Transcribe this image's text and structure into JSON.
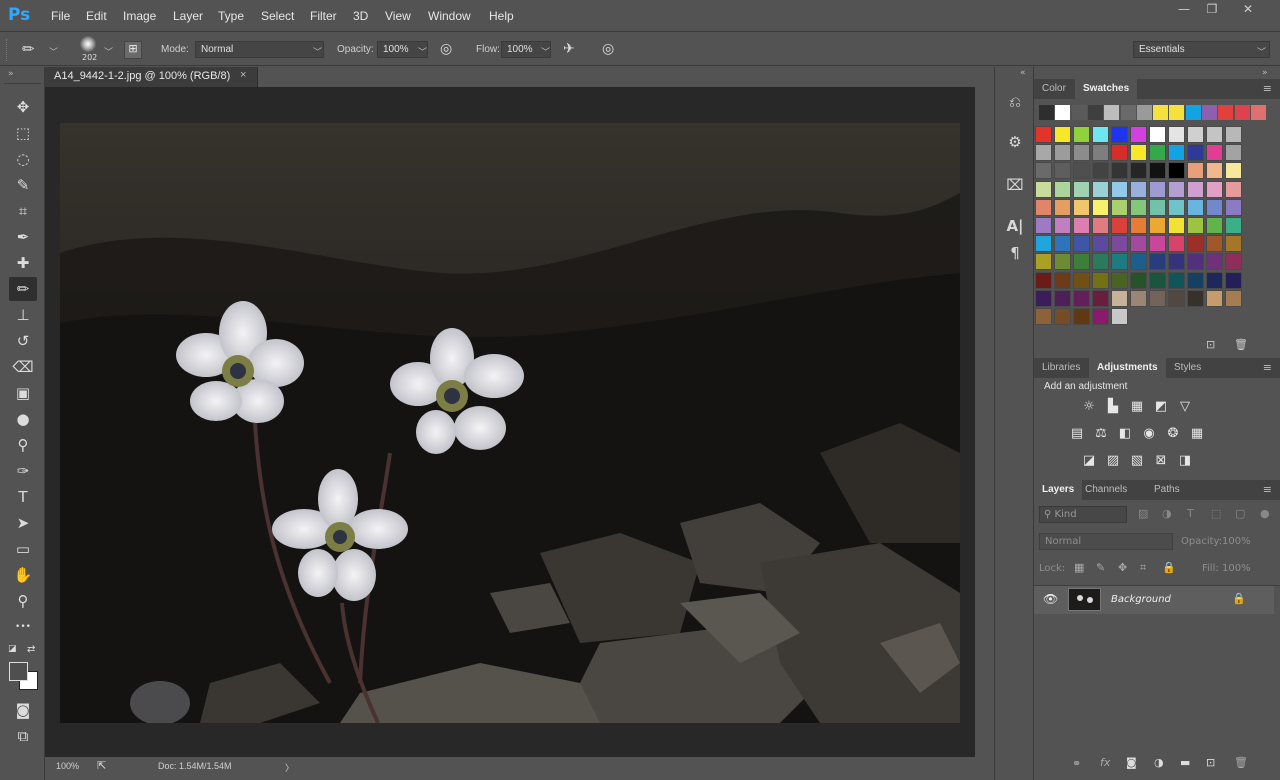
{
  "app": {
    "logo": "Ps"
  },
  "menu": [
    "File",
    "Edit",
    "Image",
    "Layer",
    "Type",
    "Select",
    "Filter",
    "3D",
    "View",
    "Window",
    "Help"
  ],
  "window_controls": {
    "minimize": "—",
    "restore": "❐",
    "close": "✕"
  },
  "options_bar": {
    "brush_size": "202",
    "mode_label": "Mode:",
    "mode_value": "Normal",
    "opacity_label": "Opacity:",
    "opacity_value": "100%",
    "flow_label": "Flow:",
    "flow_value": "100%",
    "workspace": "Essentials"
  },
  "document": {
    "tab_title": "A14_9442-1-2.jpg @ 100% (RGB/8)",
    "tab_close": "×",
    "zoom": "100%",
    "doc_info": "Doc: 1.54M/1.54M",
    "status_arrow": "〉"
  },
  "tools": [
    {
      "name": "move-tool",
      "glyph": "✥"
    },
    {
      "name": "marquee-tool",
      "glyph": "⬚"
    },
    {
      "name": "lasso-tool",
      "glyph": "◌"
    },
    {
      "name": "quick-selection-tool",
      "glyph": "✎"
    },
    {
      "name": "crop-tool",
      "glyph": "⌗"
    },
    {
      "name": "eyedropper-tool",
      "glyph": "✒"
    },
    {
      "name": "healing-brush-tool",
      "glyph": "✚"
    },
    {
      "name": "brush-tool",
      "glyph": "✏"
    },
    {
      "name": "clone-stamp-tool",
      "glyph": "⊥"
    },
    {
      "name": "history-brush-tool",
      "glyph": "↺"
    },
    {
      "name": "eraser-tool",
      "glyph": "⌫"
    },
    {
      "name": "gradient-tool",
      "glyph": "▣"
    },
    {
      "name": "blur-tool",
      "glyph": "●"
    },
    {
      "name": "dodge-tool",
      "glyph": "⚲"
    },
    {
      "name": "pen-tool",
      "glyph": "✑"
    },
    {
      "name": "type-tool",
      "glyph": "T"
    },
    {
      "name": "path-selection-tool",
      "glyph": "➤"
    },
    {
      "name": "rectangle-tool",
      "glyph": "▭"
    },
    {
      "name": "hand-tool",
      "glyph": "✋"
    },
    {
      "name": "zoom-tool",
      "glyph": "⚲"
    },
    {
      "name": "more-tools",
      "glyph": "•••"
    }
  ],
  "panels": {
    "color_tab": "Color",
    "swatches_tab": "Swatches",
    "libraries_tab": "Libraries",
    "adjustments_tab": "Adjustments",
    "styles_tab": "Styles",
    "add_adjustment": "Add an adjustment",
    "layers_tab": "Layers",
    "channels_tab": "Channels",
    "paths_tab": "Paths",
    "kind_filter": "Kind",
    "blend_mode": "Normal",
    "opacity_label": "Opacity:",
    "opacity_value": "100%",
    "lock_label": "Lock:",
    "fill_label": "Fill:",
    "fill_value": "100%",
    "layer_name": "Background"
  },
  "swatch_recent": [
    "#2e2e2e",
    "#ffffff",
    "#5a5a5a",
    "#3f3f3f",
    "#bdbdbd",
    "#6a6a6a",
    "#9a9a9a",
    "#f2e23b",
    "#f2e23b",
    "#10a4e3",
    "#8d5fae",
    "#e1413a",
    "#e0414e",
    "#e07070"
  ],
  "swatch_grid": [
    [
      "#e2342a",
      "#f6e829",
      "#90d13c",
      "#6ee6ef",
      "#1e35f0",
      "#d53fe1",
      "#ffffff",
      "#e4e4e4",
      "#d0d0d0",
      "#c4c4c4",
      "#b8b8b8"
    ],
    [
      "#a8a8a8",
      "#9c9c9c",
      "#8c8c8c",
      "#7e7e7e",
      "#d72d2a",
      "#f7e82a",
      "#33a94a",
      "#11a4e3",
      "#2e3a95",
      "#e13d93",
      "#a3a3a3"
    ],
    [
      "#6a6a6a",
      "#5e5e5e",
      "#4f4f4f",
      "#434343",
      "#353535",
      "#262626",
      "#121212",
      "#000000",
      "#e8a07c",
      "#f0b88c",
      "#f6e99a"
    ],
    [
      "#c9dc9c",
      "#acd59b",
      "#9ed2b0",
      "#9ad1d4",
      "#93c9e8",
      "#9ab0dc",
      "#a09ad3",
      "#b49fd3",
      "#cf9fd0",
      "#e39fc4",
      "#e69b9b"
    ],
    [
      "#e0846a",
      "#e59e62",
      "#efc76a",
      "#f9f16a",
      "#a9d06c",
      "#83c77b",
      "#72c2a8",
      "#6ec4c6",
      "#69b5e1",
      "#7188cc",
      "#8a7bc3"
    ],
    [
      "#9d7ac2",
      "#c07fbf",
      "#dc7fb0",
      "#e07b83",
      "#d9423b",
      "#e57d37",
      "#eca835",
      "#f2e232",
      "#9dc342",
      "#5fb54a",
      "#3caf87"
    ],
    [
      "#20a5dc",
      "#2e74bb",
      "#3f56a6",
      "#5a4ba0",
      "#7b4a9f",
      "#a24aa0",
      "#c8469c",
      "#d8436a",
      "#9c2f28",
      "#a1572a",
      "#a57628"
    ],
    [
      "#a9a026",
      "#6c8c33",
      "#3d7e38",
      "#2a7b5e",
      "#1f7b82",
      "#1b5f8c",
      "#263e7c",
      "#38327b",
      "#53307b",
      "#70307a",
      "#8f2e5a"
    ],
    [
      "#6b1c18",
      "#6d3b19",
      "#715018",
      "#747114",
      "#4a6322",
      "#265428",
      "#1a5540",
      "#105659",
      "#153f63",
      "#1c295a",
      "#251f59"
    ],
    [
      "#3a1d59",
      "#4e1f58",
      "#631f59",
      "#6a1e3f",
      "#c7b299",
      "#998675",
      "#736358",
      "#534741",
      "#37312c",
      "#c69c6d",
      "#a67c52"
    ],
    [
      "#8c6239",
      "#754c24",
      "#603913",
      "#8b1a6a",
      "#c8c8c8"
    ]
  ]
}
